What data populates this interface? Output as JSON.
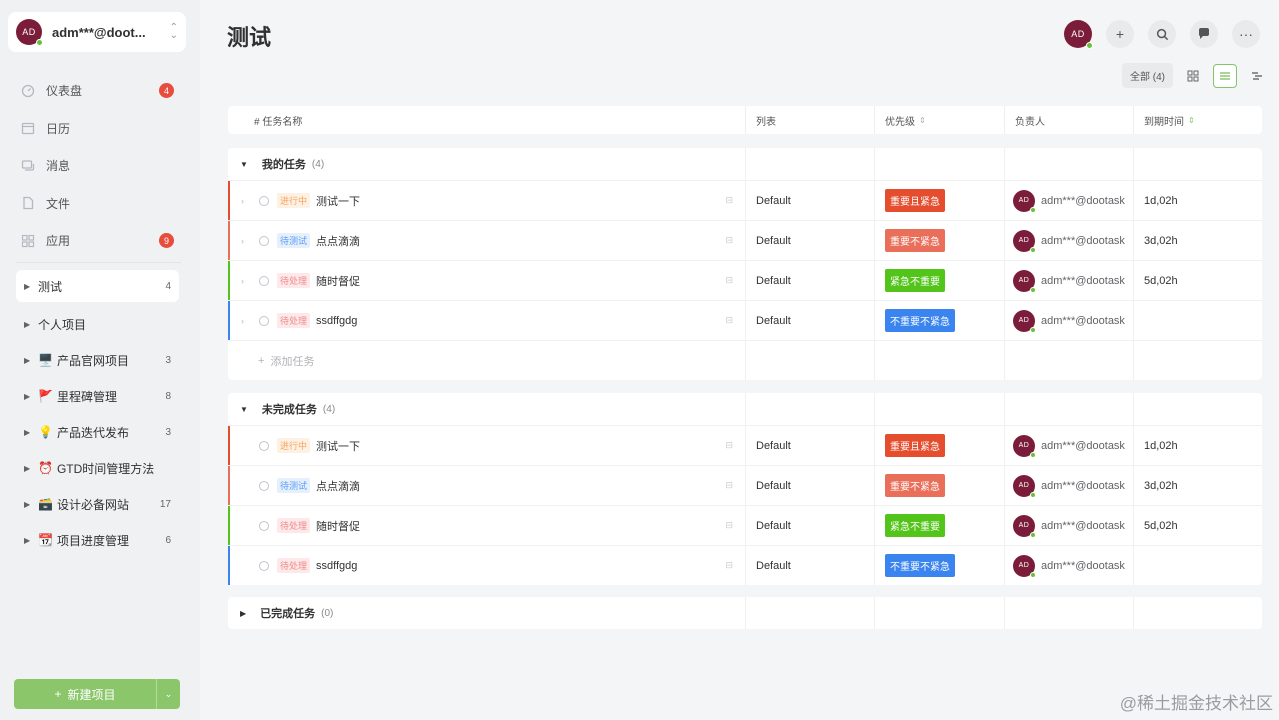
{
  "user": {
    "initials": "AD",
    "name": "adm***@doot..."
  },
  "nav": [
    {
      "label": "仪表盘",
      "icon": "dashboard-icon",
      "badge": "4"
    },
    {
      "label": "日历",
      "icon": "calendar-icon",
      "badge": ""
    },
    {
      "label": "消息",
      "icon": "message-icon",
      "badge": ""
    },
    {
      "label": "文件",
      "icon": "file-icon",
      "badge": ""
    },
    {
      "label": "应用",
      "icon": "apps-icon",
      "badge": "9"
    }
  ],
  "projects": [
    {
      "emoji": "",
      "label": "测试",
      "count": "4",
      "active": true
    },
    {
      "emoji": "",
      "label": "个人项目",
      "count": ""
    },
    {
      "emoji": "🖥️",
      "label": "产品官网项目",
      "count": "3"
    },
    {
      "emoji": "🚩",
      "label": "里程碑管理",
      "count": "8"
    },
    {
      "emoji": "💡",
      "label": "产品迭代发布",
      "count": "3"
    },
    {
      "emoji": "⏰",
      "label": "GTD时间管理方法",
      "count": ""
    },
    {
      "emoji": "🗃️",
      "label": "设计必备网站",
      "count": "17"
    },
    {
      "emoji": "📆",
      "label": "项目进度管理",
      "count": "6"
    }
  ],
  "new_project": "新建项目",
  "page_title": "测试",
  "filter_all": "全部 (4)",
  "columns": {
    "name": "# 任务名称",
    "list": "列表",
    "priority": "优先级",
    "owner": "负责人",
    "due": "到期时间"
  },
  "groups": [
    {
      "title": "我的任务",
      "count": "(4)",
      "expanded": true,
      "add_task": "添加任务",
      "tasks": [
        {
          "status": "进行中",
          "status_style": "orange",
          "name": "测试一下",
          "list": "Default",
          "priority": "重要且紧急",
          "priority_color": "#e44d2e",
          "owner": "adm***@dootask",
          "due": "1d,02h",
          "bar": "#e44d2e"
        },
        {
          "status": "待测试",
          "status_style": "blue",
          "name": "点点滴滴",
          "list": "Default",
          "priority": "重要不紧急",
          "priority_color": "#ea6f5a",
          "owner": "adm***@dootask",
          "due": "3d,02h",
          "bar": "#ea6f5a"
        },
        {
          "status": "待处理",
          "status_style": "red",
          "name": "随时督促",
          "list": "Default",
          "priority": "紧急不重要",
          "priority_color": "#52c41a",
          "owner": "adm***@dootask",
          "due": "5d,02h",
          "bar": "#52c41a"
        },
        {
          "status": "待处理",
          "status_style": "red",
          "name": "ssdffgdg",
          "list": "Default",
          "priority": "不重要不紧急",
          "priority_color": "#3a84f0",
          "owner": "adm***@dootask",
          "due": "",
          "bar": "#3a84f0"
        }
      ]
    },
    {
      "title": "未完成任务",
      "count": "(4)",
      "expanded": true,
      "tasks": [
        {
          "status": "进行中",
          "status_style": "orange",
          "name": "测试一下",
          "list": "Default",
          "priority": "重要且紧急",
          "priority_color": "#e44d2e",
          "owner": "adm***@dootask",
          "due": "1d,02h",
          "bar": "#e44d2e"
        },
        {
          "status": "待测试",
          "status_style": "blue",
          "name": "点点滴滴",
          "list": "Default",
          "priority": "重要不紧急",
          "priority_color": "#ea6f5a",
          "owner": "adm***@dootask",
          "due": "3d,02h",
          "bar": "#ea6f5a"
        },
        {
          "status": "待处理",
          "status_style": "red",
          "name": "随时督促",
          "list": "Default",
          "priority": "紧急不重要",
          "priority_color": "#52c41a",
          "owner": "adm***@dootask",
          "due": "5d,02h",
          "bar": "#52c41a"
        },
        {
          "status": "待处理",
          "status_style": "red",
          "name": "ssdffgdg",
          "list": "Default",
          "priority": "不重要不紧急",
          "priority_color": "#3a84f0",
          "owner": "adm***@dootask",
          "due": "",
          "bar": "#3a84f0"
        }
      ]
    },
    {
      "title": "已完成任务",
      "count": "(0)",
      "expanded": false,
      "tasks": []
    }
  ],
  "watermark": "@稀土掘金技术社区"
}
